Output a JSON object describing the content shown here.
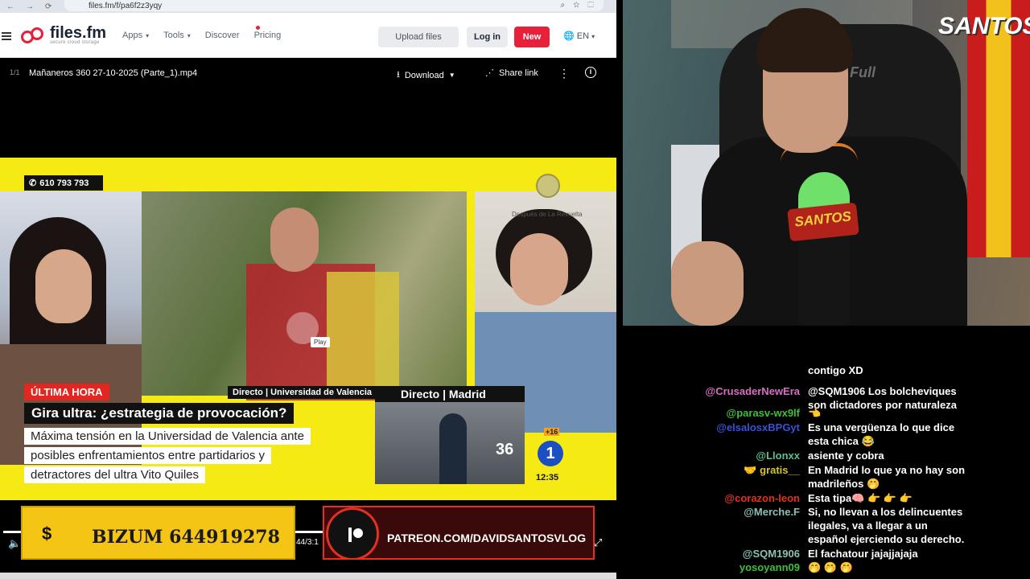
{
  "browser": {
    "url": "files.fm/f/pa6f2z3yqy",
    "logo_name": "files.fm",
    "logo_tagline": "secure cloud storage",
    "menu": [
      {
        "label": "Apps",
        "has_dropdown": true
      },
      {
        "label": "Tools",
        "has_dropdown": true
      },
      {
        "label": "Discover",
        "has_dropdown": false
      },
      {
        "label": "Pricing",
        "has_dropdown": false
      }
    ],
    "upload_label": "Upload files",
    "login_label": "Log in",
    "new_label": "New",
    "lang_label": "EN",
    "accent_color": "#e8203a"
  },
  "file": {
    "index": "1/1",
    "name": "Mañaneros 360 27-10-2025 (Parte_1).mp4",
    "download_label": "Download",
    "share_label": "Share link"
  },
  "video": {
    "phone": "610 793 793",
    "channel_text": "Después de La Revuelta",
    "play_tooltip": "Play",
    "label_directo": "Directo | Universidad de Valencia",
    "label_madrid": "Directo | Madrid",
    "breaking": "ÚLTIMA HORA",
    "headline": "Gira ultra: ¿estrategia de provocación?",
    "subtitle_lines": [
      "Máxima tensión en la Universidad de Valencia ante",
      "posibles enfrentamientos entre partidarios y",
      "detractores del ultra Vito Quiles"
    ],
    "network_text": "36",
    "network_number": "1",
    "network_age": "+16",
    "clock": "12:35",
    "time_display": "44/3:1"
  },
  "overlays": {
    "bizum_symbol": "$",
    "bizum_text": "BIZUM 644919278",
    "patreon_text": "PATREON.COM/DAVIDSANTOSVLOG"
  },
  "camera": {
    "brand": "SANTOS",
    "chair_brand": "Full",
    "mic_brand": "SANTOS"
  },
  "chat": {
    "messages": [
      {
        "user": "",
        "user_color": "#8cc0b4",
        "lines": [
          "contigo XD"
        ]
      },
      {
        "user": "@CrusaderNewEra",
        "user_color": "#d76fc2",
        "lines": [
          "@SQM1906 Los bolcheviques",
          "son dictadores por naturaleza"
        ]
      },
      {
        "user": "@parasv-wx9lf",
        "user_color": "#3fbf3a",
        "lines": [
          "👈"
        ]
      },
      {
        "user": "@elsalosxBPGyt",
        "user_color": "#3a50d8",
        "lines": [
          "Es una vergüenza lo que dice",
          "esta chica 😂"
        ]
      },
      {
        "user": "@Llonxx",
        "user_color": "#5bbf8f",
        "lines": [
          "asiente y cobra"
        ]
      },
      {
        "user": "🤝 gratis__",
        "user_color": "#d9c22a",
        "lines": [
          "En Madrid lo que ya no hay son",
          "madrileños 🤭"
        ]
      },
      {
        "user": "@corazon-leon",
        "user_color": "#e5301f",
        "lines": [
          "Esta tipa🧠 👉 👉 👉"
        ]
      },
      {
        "user": "@Merche.F",
        "user_color": "#8cc0b4",
        "lines": [
          "Si, no llevan a los delincuentes",
          "ilegales, va a llegar a un",
          "español ejerciendo su derecho."
        ]
      },
      {
        "user": "@SQM1906",
        "user_color": "#8cc0b4",
        "lines": [
          "El fachatour jajajjajaja"
        ]
      },
      {
        "user": "yosoyann09",
        "user_color": "#3fbf3a",
        "lines": [
          "🤭 🤭 🤭"
        ]
      }
    ]
  }
}
